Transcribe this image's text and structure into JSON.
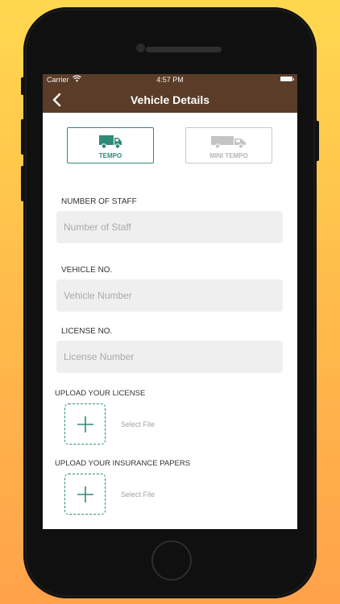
{
  "status_bar": {
    "carrier": "Carrier",
    "time": "4:57 PM"
  },
  "header": {
    "title": "Vehicle Details"
  },
  "vehicle_types": [
    {
      "label": "TEMPO",
      "selected": true,
      "icon": "truck-icon"
    },
    {
      "label": "MINI TEMPO",
      "selected": false,
      "icon": "pickup-truck-icon"
    }
  ],
  "fields": {
    "staff": {
      "label": "NUMBER OF STAFF",
      "placeholder": "Number of Staff",
      "value": ""
    },
    "vehicle": {
      "label": "VEHICLE NO.",
      "placeholder": "Vehicle Number",
      "value": ""
    },
    "license": {
      "label": "LICENSE NO.",
      "placeholder": "License Number",
      "value": ""
    }
  },
  "uploads": {
    "license": {
      "label": "UPLOAD YOUR LICENSE",
      "action": "Select File"
    },
    "insurance": {
      "label": "UPLOAD YOUR INSURANCE PAPERS",
      "action": "Select File"
    }
  },
  "colors": {
    "accent": "#2e8b7a",
    "header": "#5a3c28",
    "background": "#ffc94c"
  }
}
